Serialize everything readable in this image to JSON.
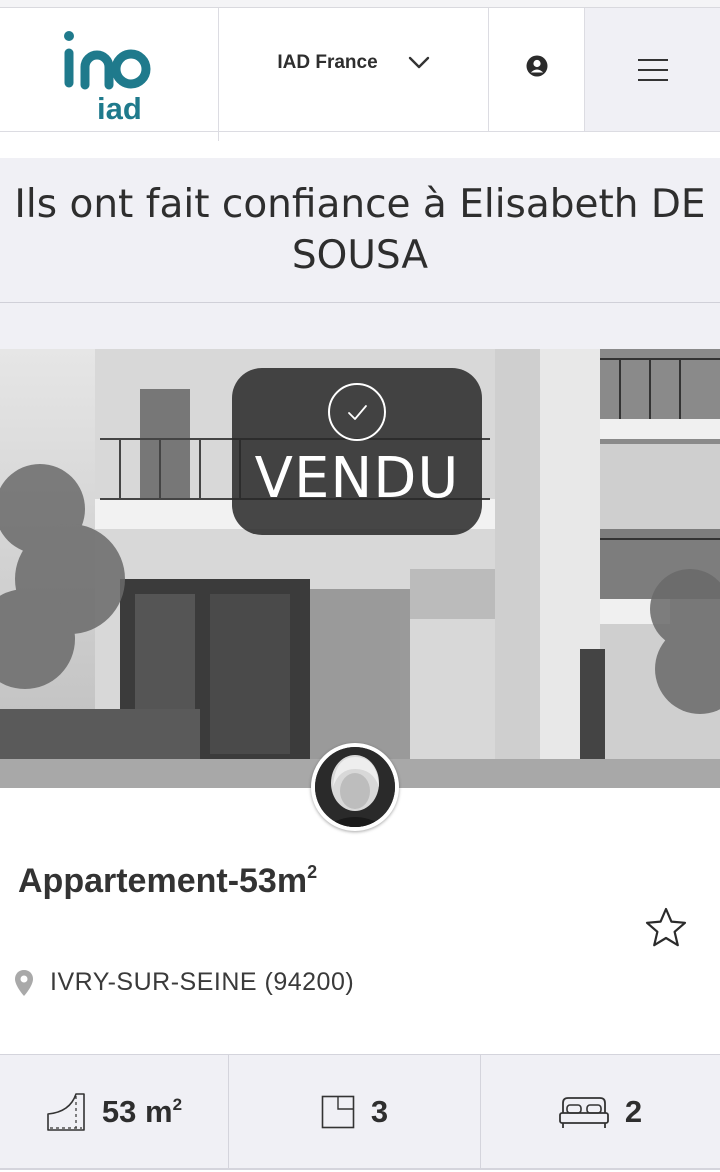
{
  "header": {
    "logo_text": "iad",
    "country_label": "IAD France"
  },
  "page": {
    "title": "Ils ont fait confiance à Elisabeth DE SOUSA"
  },
  "listing": {
    "badge": "VENDU",
    "title": "Appartement-53m",
    "title_sup": "2",
    "location": "IVRY-SUR-SEINE (94200)",
    "features": {
      "area_value": "53 m",
      "area_sup": "2",
      "rooms": "3",
      "bedrooms": "2"
    }
  },
  "colors": {
    "brand_teal": "#1f7a8c",
    "band_bg": "#f0f0f5"
  },
  "icons": [
    "user-icon",
    "chevron-down-icon",
    "menu-icon",
    "check-icon",
    "star-icon",
    "location-pin-icon",
    "area-icon",
    "rooms-icon",
    "bed-icon"
  ]
}
